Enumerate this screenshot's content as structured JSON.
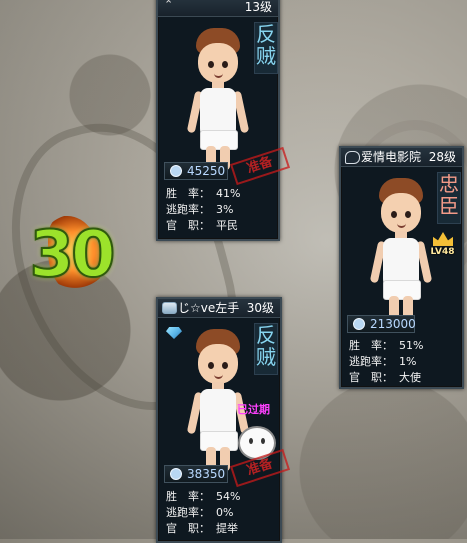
{
  "timer": {
    "value": "30"
  },
  "cards": [
    {
      "name": "",
      "level": "13级",
      "role": [
        "反",
        "贼"
      ],
      "stamp": "准备",
      "coins": "45250",
      "stats": [
        {
          "label": "胜　率：",
          "value": "41%"
        },
        {
          "label": "逃跑率：",
          "value": "3%"
        },
        {
          "label": "官　职：",
          "value": "平民"
        }
      ]
    },
    {
      "name": "爱情电影院",
      "level": "28级",
      "role": [
        "忠",
        "臣"
      ],
      "badge_level": "LV48",
      "coins": "213000",
      "stats": [
        {
          "label": "胜　率：",
          "value": "51%"
        },
        {
          "label": "逃跑率：",
          "value": "1%"
        },
        {
          "label": "官　职：",
          "value": "大使"
        }
      ]
    },
    {
      "name": "じ☆ve左手",
      "level": "30级",
      "role": [
        "反",
        "贼"
      ],
      "expired": "已过期",
      "stamp": "准备",
      "coins": "38350",
      "stats": [
        {
          "label": "胜　率：",
          "value": "54%"
        },
        {
          "label": "逃跑率：",
          "value": "0%"
        },
        {
          "label": "官　职：",
          "value": "提举"
        }
      ]
    }
  ]
}
